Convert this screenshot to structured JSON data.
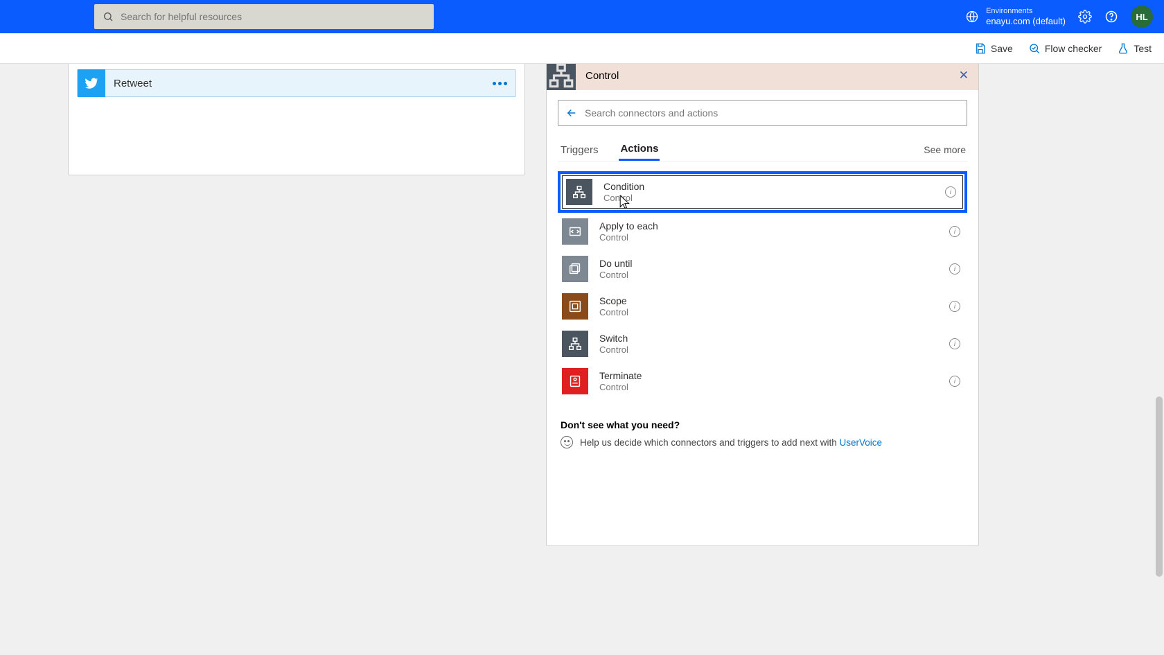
{
  "header": {
    "search_placeholder": "Search for helpful resources",
    "env_label": "Environments",
    "env_name": "enayu.com (default)",
    "avatar_initials": "HL"
  },
  "commands": {
    "save": "Save",
    "flow_checker": "Flow checker",
    "test": "Test"
  },
  "left_step": {
    "title": "Retweet"
  },
  "panel": {
    "title": "Control",
    "search_placeholder": "Search connectors and actions",
    "tabs": {
      "triggers": "Triggers",
      "actions": "Actions"
    },
    "see_more": "See more",
    "actions": [
      {
        "name": "Condition",
        "sub": "Control",
        "color": "#4a5560",
        "selected": true
      },
      {
        "name": "Apply to each",
        "sub": "Control",
        "color": "#7d8893",
        "selected": false
      },
      {
        "name": "Do until",
        "sub": "Control",
        "color": "#7d8893",
        "selected": false
      },
      {
        "name": "Scope",
        "sub": "Control",
        "color": "#8a4b1a",
        "selected": false
      },
      {
        "name": "Switch",
        "sub": "Control",
        "color": "#4a5560",
        "selected": false
      },
      {
        "name": "Terminate",
        "sub": "Control",
        "color": "#e02020",
        "selected": false
      }
    ],
    "help_title": "Don't see what you need?",
    "help_text": "Help us decide which connectors and triggers to add next with ",
    "help_link": "UserVoice"
  }
}
